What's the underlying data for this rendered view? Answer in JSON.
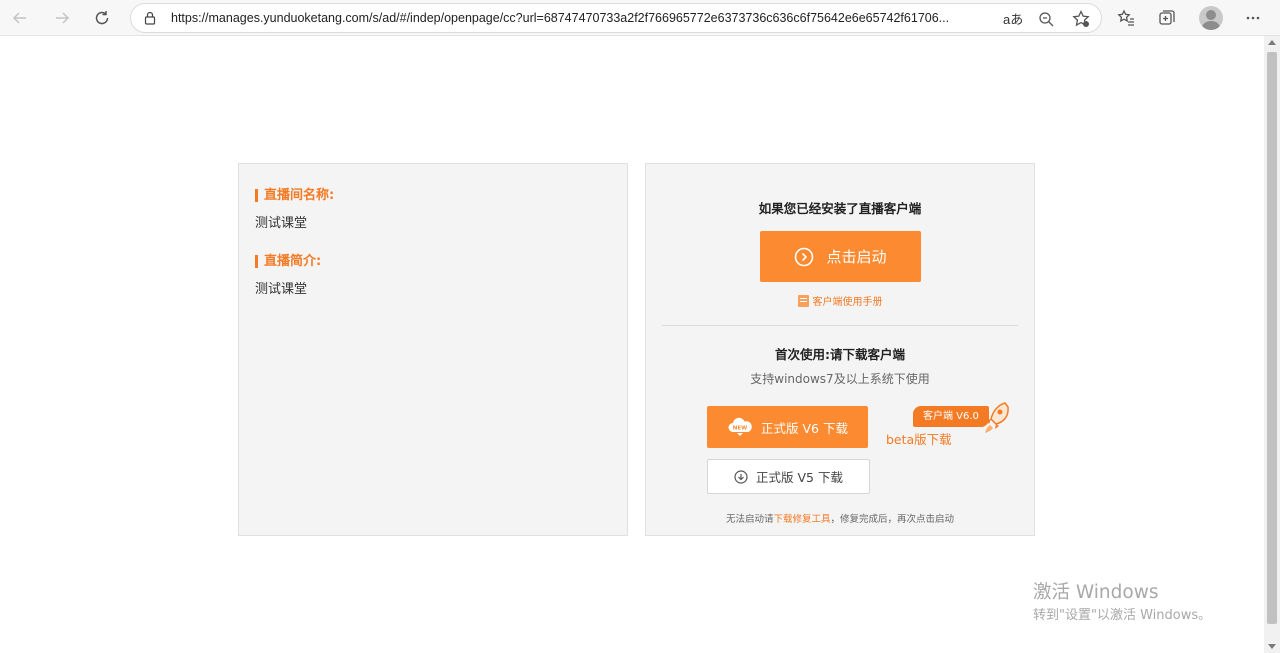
{
  "browser": {
    "url": "https://manages.yunduoketang.com/s/ad/#/indep/openpage/cc?url=68747470733a2f2f766965772e6373736c636c6f75642e6e65742f61706...",
    "read_aloud_label": "aあ"
  },
  "left_panel": {
    "room_name_label": "直播间名称:",
    "room_name_value": "测试课堂",
    "room_intro_label": "直播简介:",
    "room_intro_value": "测试课堂"
  },
  "right_panel": {
    "installed_heading": "如果您已经安装了直播客户端",
    "launch_button": "点击启动",
    "manual_link": "客户端使用手册",
    "first_use_heading": "首次使用:请下载客户端",
    "support_text": "支持windows7及以上系统下使用",
    "download_v6": "正式版 V6 下载",
    "new_badge": "NEW",
    "download_v5": "正式版 V5 下载",
    "beta_tag": "客户端 V6.0",
    "beta_link": "beta版下载",
    "repair_prefix": "无法启动请",
    "repair_link": "下载修复工具",
    "repair_suffix": "，修复完成后，再次点击启动"
  },
  "watermark": {
    "line1": "激活 Windows",
    "line2": "转到\"设置\"以激活 Windows。"
  },
  "colors": {
    "accent": "#fb8a30",
    "panel_bg": "#f4f4f4"
  }
}
